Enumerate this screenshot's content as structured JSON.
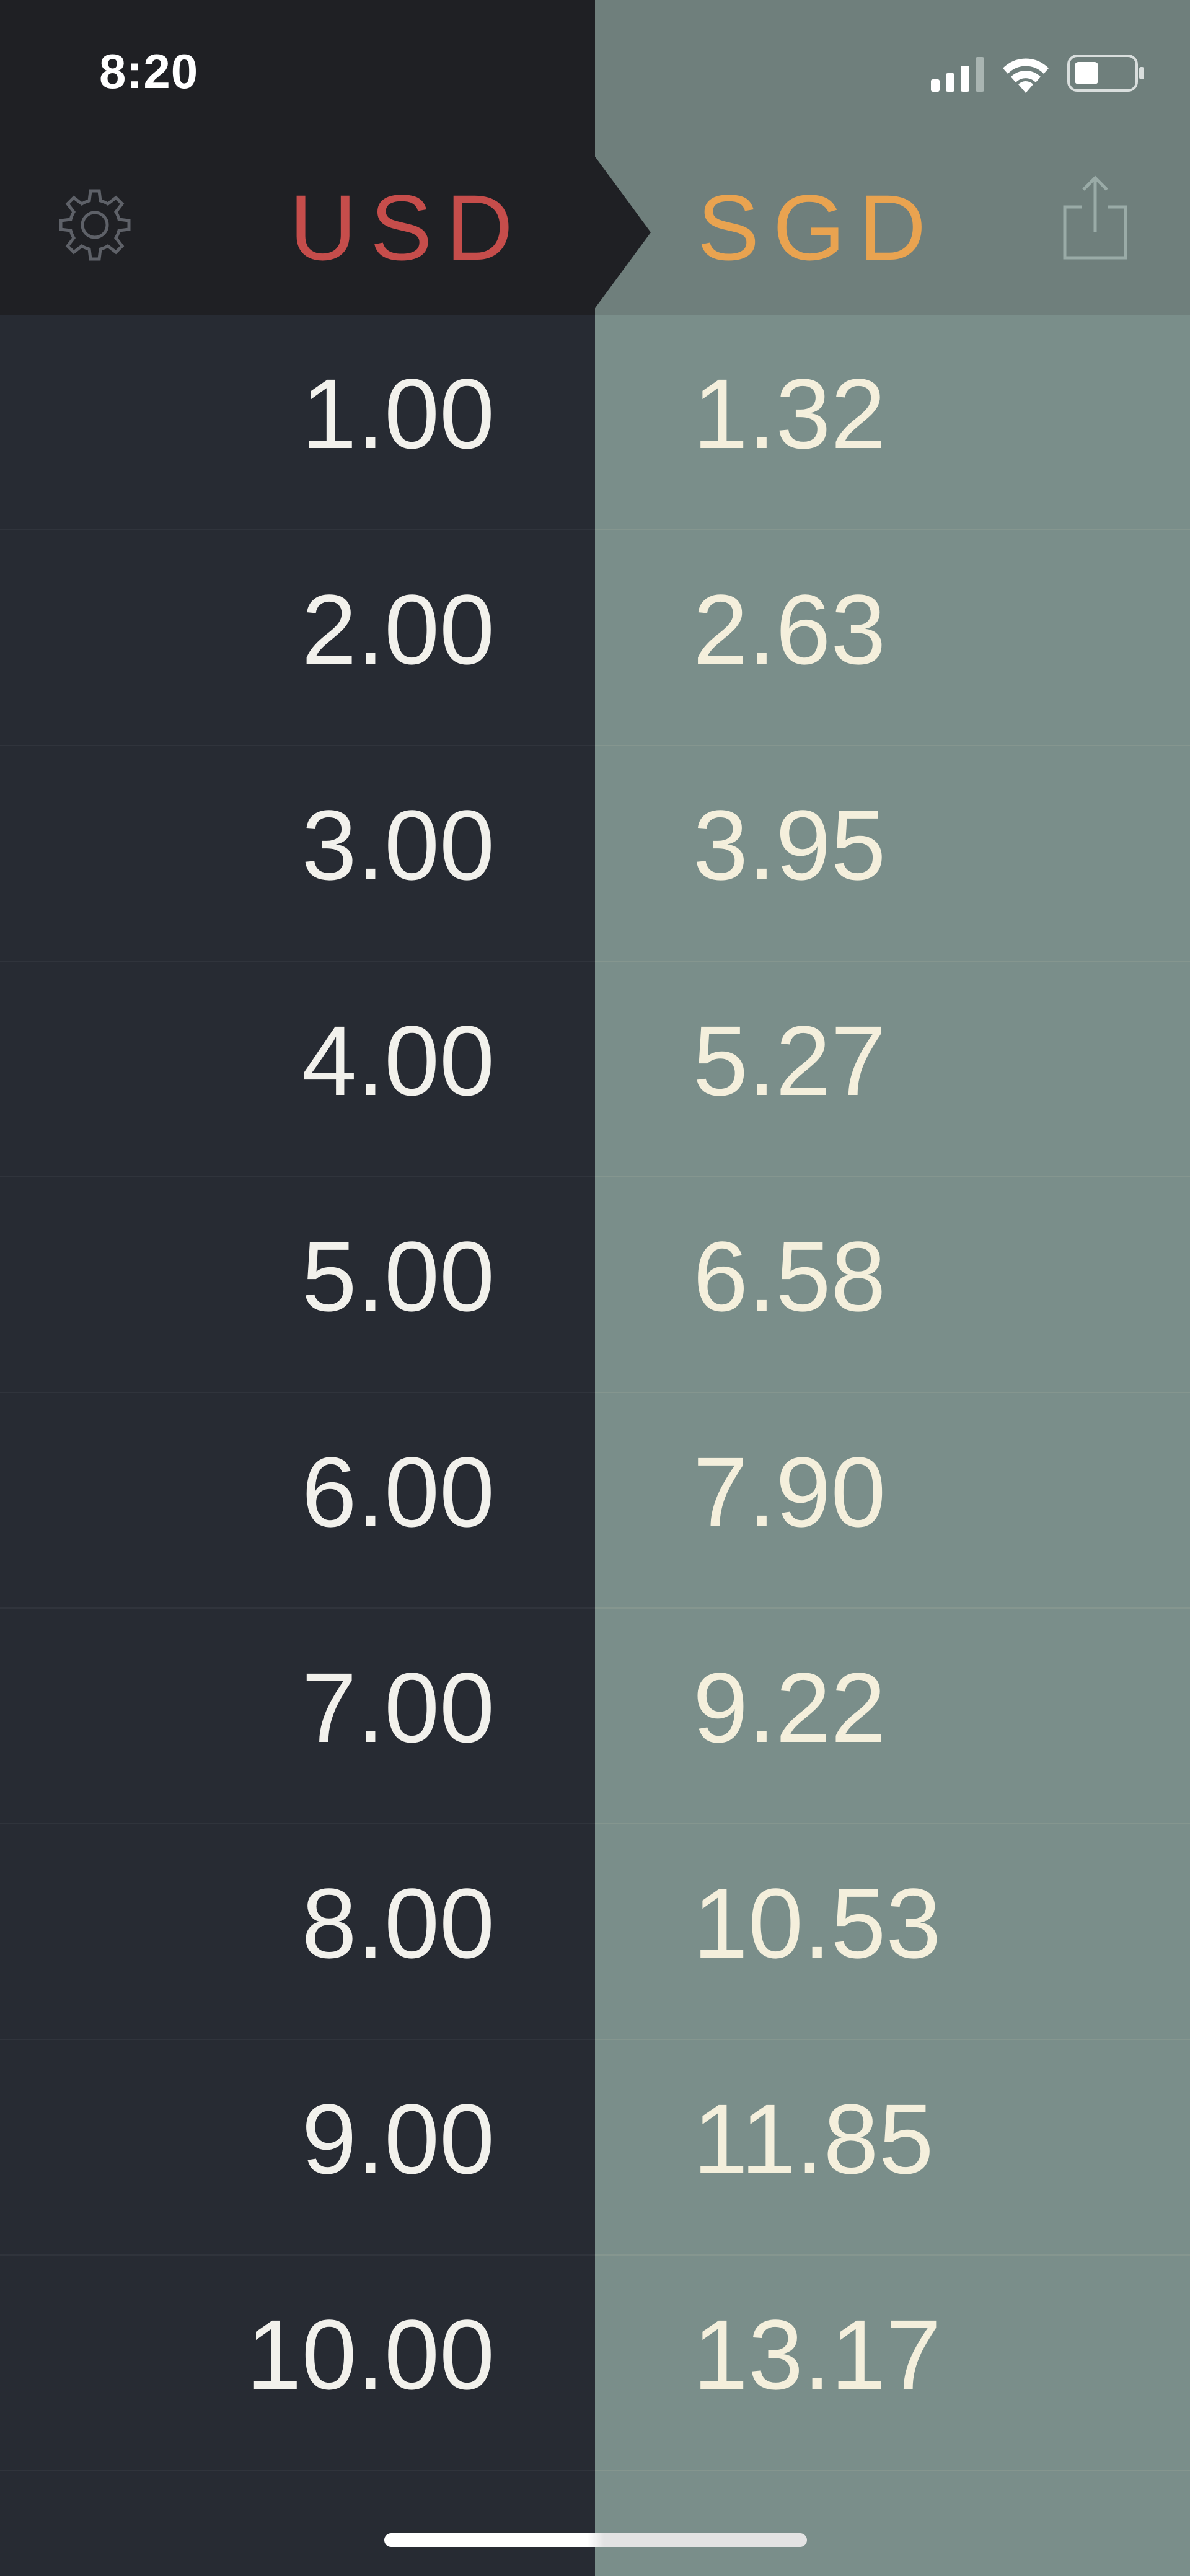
{
  "status_bar": {
    "time": "8:20",
    "icons": [
      "signal-icon",
      "wifi-icon",
      "battery-icon"
    ]
  },
  "header": {
    "from_currency": "USD",
    "to_currency": "SGD",
    "settings_icon": "gear-icon",
    "share_icon": "share-icon"
  },
  "colors": {
    "from_currency": "#c64d4b",
    "to_currency": "#e9a350",
    "left_panel": "#272b33",
    "right_panel": "#7a8e8a"
  },
  "rows": [
    {
      "from": "1.00",
      "to": "1.32"
    },
    {
      "from": "2.00",
      "to": "2.63"
    },
    {
      "from": "3.00",
      "to": "3.95"
    },
    {
      "from": "4.00",
      "to": "5.27"
    },
    {
      "from": "5.00",
      "to": "6.58"
    },
    {
      "from": "6.00",
      "to": "7.90"
    },
    {
      "from": "7.00",
      "to": "9.22"
    },
    {
      "from": "8.00",
      "to": "10.53"
    },
    {
      "from": "9.00",
      "to": "11.85"
    },
    {
      "from": "10.00",
      "to": "13.17"
    }
  ]
}
